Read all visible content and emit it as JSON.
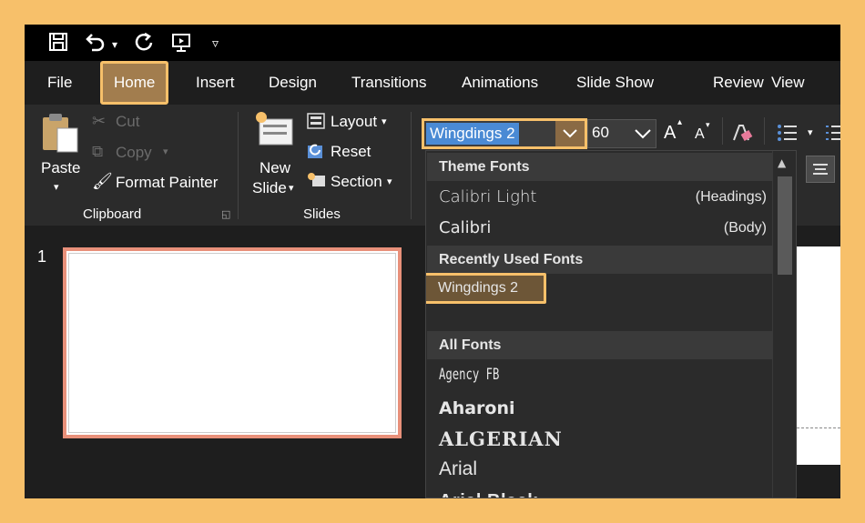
{
  "qat": {
    "save_icon": "save-icon",
    "undo_icon": "undo-icon",
    "redo_icon": "redo-icon",
    "present_icon": "present-from-start-icon",
    "customize_icon": "customize-qat-icon"
  },
  "tabs": [
    {
      "label": "File"
    },
    {
      "label": "Home",
      "active": true
    },
    {
      "label": "Insert"
    },
    {
      "label": "Design"
    },
    {
      "label": "Transitions"
    },
    {
      "label": "Animations"
    },
    {
      "label": "Slide Show"
    },
    {
      "label": "Review"
    },
    {
      "label": "View"
    }
  ],
  "clipboard": {
    "paste": "Paste",
    "cut": "Cut",
    "copy": "Copy",
    "format_painter": "Format Painter",
    "group_label": "Clipboard"
  },
  "slides": {
    "new_slide_line1": "New",
    "new_slide_line2": "Slide",
    "layout": "Layout",
    "reset": "Reset",
    "section": "Section",
    "group_label": "Slides"
  },
  "font": {
    "current_font": "Wingdings 2",
    "current_size": "60",
    "grow_label": "A",
    "shrink_label": "A"
  },
  "left_pane": {
    "slide_number": "1"
  },
  "dropdown": {
    "theme_header": "Theme Fonts",
    "theme_fonts": [
      {
        "name": "Calibri Light",
        "tag": "(Headings)"
      },
      {
        "name": "Calibri",
        "tag": "(Body)"
      }
    ],
    "recent_header": "Recently Used Fonts",
    "recent_fonts": [
      "Wingdings 2"
    ],
    "all_header": "All Fonts",
    "all_fonts": [
      "Agency FB",
      "Aharoni",
      "ALGERIAN",
      "Arial",
      "Arial Black"
    ]
  },
  "colors": {
    "highlight": "#f7c06a",
    "active_tab": "#a27d4e",
    "selection_blue": "#4a8ad4",
    "thumb_border": "#e8907a"
  }
}
